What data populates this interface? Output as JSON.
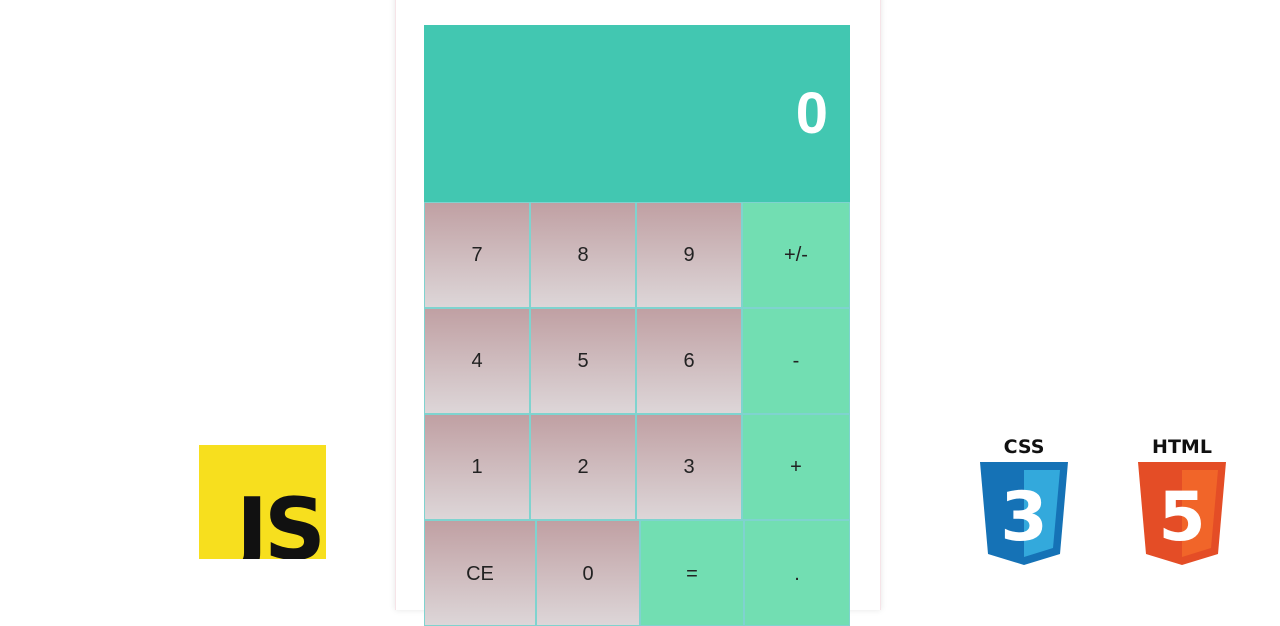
{
  "display": {
    "value": "0"
  },
  "keys": {
    "k7": "7",
    "k8": "8",
    "k9": "9",
    "sign": "+/-",
    "k4": "4",
    "k5": "5",
    "k6": "6",
    "minus": "-",
    "k1": "1",
    "k2": "2",
    "k3": "3",
    "plus": "+",
    "ce": "CE",
    "k0": "0",
    "equals": "=",
    "dot": "."
  },
  "logos": {
    "js": "JS",
    "css": "CSS",
    "css_num": "3",
    "html": "HTML",
    "html_num": "5"
  },
  "colors": {
    "display_bg": "#42c7b1",
    "number_key_top": "#c0a0a3",
    "number_key_bottom": "#ddd6d8",
    "operator_key": "#72deb2",
    "js_yellow": "#f7df1e",
    "css_blue": "#2965f1",
    "html_orange": "#e44d26"
  }
}
